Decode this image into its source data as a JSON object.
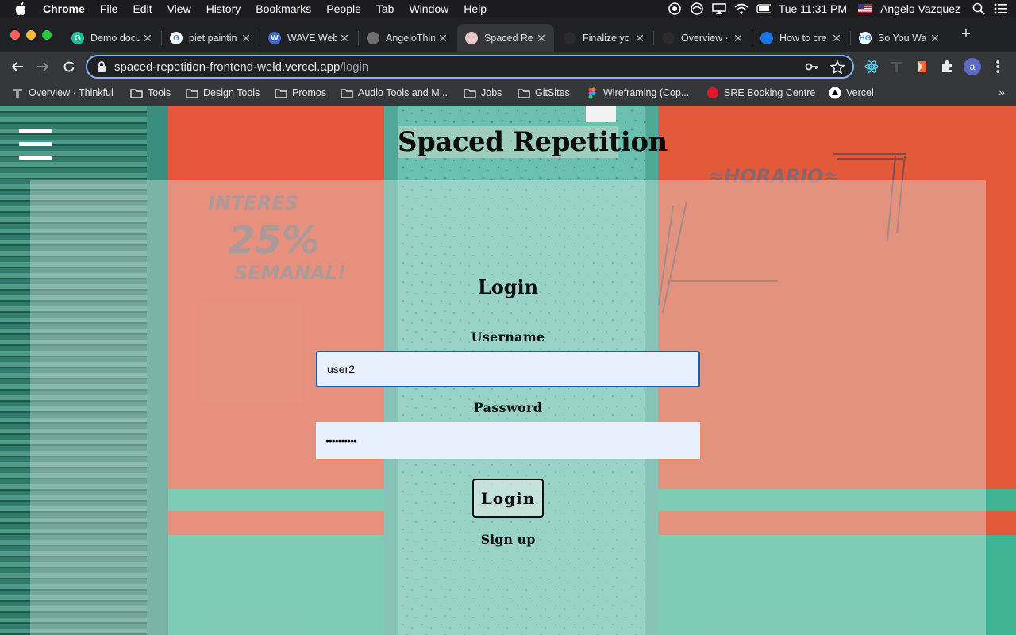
{
  "menubar": {
    "app": "Chrome",
    "items": [
      "File",
      "Edit",
      "View",
      "History",
      "Bookmarks",
      "People",
      "Tab",
      "Window",
      "Help"
    ],
    "clock": "Tue 11:31 PM",
    "user": "Angelo Vazquez"
  },
  "tabs": [
    {
      "title": "Demo docu",
      "icon": "grammarly-icon",
      "color": "#15c39a",
      "letter": "G"
    },
    {
      "title": "piet paintin",
      "icon": "google-icon",
      "color": "#ffffff",
      "letter": "G"
    },
    {
      "title": "WAVE Web",
      "icon": "wave-icon",
      "color": "#3b6cc9",
      "letter": "W"
    },
    {
      "title": "AngeloThin",
      "icon": "globe-icon",
      "color": "#6e6e6e",
      "letter": ""
    },
    {
      "title": "Spaced Re",
      "icon": "skull-icon",
      "color": "#e8c8c8",
      "letter": ""
    },
    {
      "title": "Finalize yo",
      "icon": "thinkful-icon",
      "color": "#2b2b2b",
      "letter": ""
    },
    {
      "title": "Overview ·",
      "icon": "thinkful-icon",
      "color": "#2b2b2b",
      "letter": ""
    },
    {
      "title": "How to cre",
      "icon": "dev-icon",
      "color": "#1a73e8",
      "letter": ""
    },
    {
      "title": "So You Wa",
      "icon": "hg-icon",
      "color": "#ffffff",
      "letter": "HG"
    }
  ],
  "active_tab": 4,
  "url": {
    "host": "spaced-repetition-frontend-weld.vercel.app",
    "path": "/login"
  },
  "bookmarks": [
    {
      "label": "Overview · Thinkful",
      "icon": "thinkful-icon"
    },
    {
      "label": "Tools",
      "icon": "folder-icon"
    },
    {
      "label": "Design Tools",
      "icon": "folder-icon"
    },
    {
      "label": "Promos",
      "icon": "folder-icon"
    },
    {
      "label": "Audio Tools and M...",
      "icon": "folder-icon"
    },
    {
      "label": "Jobs",
      "icon": "folder-icon"
    },
    {
      "label": "GitSites",
      "icon": "folder-icon"
    },
    {
      "label": "Wireframing (Cop...",
      "icon": "figma-icon"
    },
    {
      "label": "SRE Booking Centre",
      "icon": "red-circle-icon"
    },
    {
      "label": "Vercel",
      "icon": "vercel-icon"
    }
  ],
  "bookmarks_more": "»",
  "site": {
    "title": "Spaced Repetition"
  },
  "form": {
    "heading": "Login",
    "username_label": "Username",
    "username_value": "user2",
    "password_label": "Password",
    "password_value": "••••••••••",
    "submit_label": "Login",
    "signup_link": "Sign up"
  },
  "colors": {
    "accent": "#8ab4f8",
    "input_bg": "#e8f0fe",
    "focus_border": "#1f5fa8"
  }
}
